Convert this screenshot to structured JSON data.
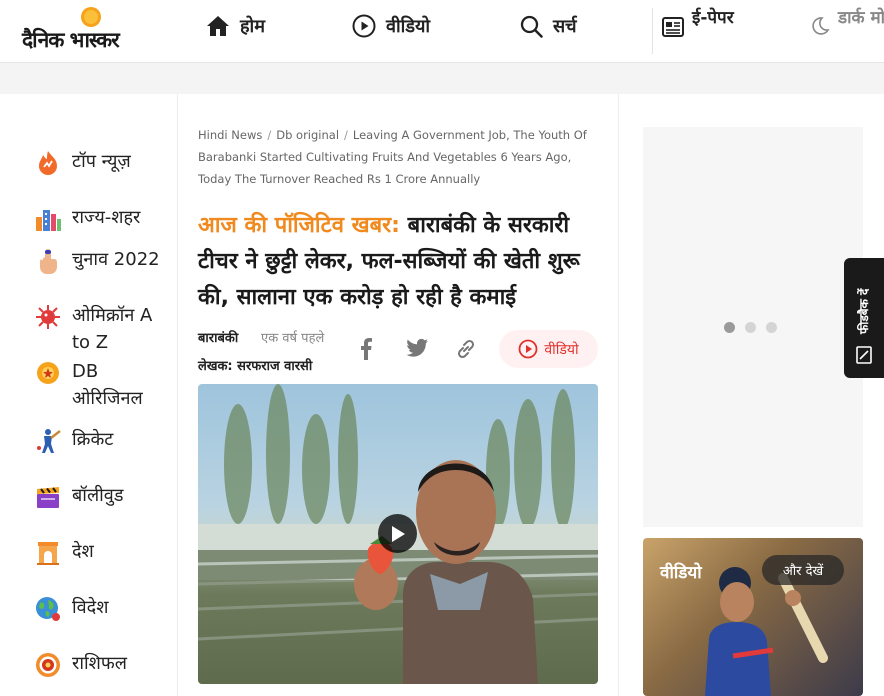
{
  "header": {
    "logo_text": "दैनिक भास्कर",
    "nav": {
      "home": "होम",
      "video": "वीडियो",
      "search": "सर्च",
      "epaper": "ई-पेपर",
      "dark_mode": "डार्क मोड"
    }
  },
  "sidebar": {
    "items": [
      {
        "label": "टॉप न्यूज़",
        "icon": "flame-icon"
      },
      {
        "label": "राज्य-शहर",
        "icon": "city-icon"
      },
      {
        "label": "चुनाव 2022",
        "icon": "voting-finger-icon"
      },
      {
        "label": "ओमिक्रॉन A to Z",
        "icon": "virus-icon"
      },
      {
        "label": "DB ओरिजिनल",
        "icon": "db-original-icon"
      },
      {
        "label": "क्रिकेट",
        "icon": "cricket-icon"
      },
      {
        "label": "बॉलीवुड",
        "icon": "clapperboard-icon"
      },
      {
        "label": "देश",
        "icon": "india-gate-icon"
      },
      {
        "label": "विदेश",
        "icon": "globe-icon"
      },
      {
        "label": "राशिफल",
        "icon": "zodiac-icon"
      }
    ]
  },
  "article": {
    "breadcrumb": {
      "home": "Hindi News",
      "section": "Db original",
      "current": "Leaving A Government Job, The Youth Of Barabanki Started Cultivating Fruits And Vegetables 6 Years Ago, Today The Turnover Reached Rs 1 Crore Annually"
    },
    "kicker": "आज की पॉजिटिव खबर:",
    "headline": "बाराबंकी के सरकारी टीचर ने छुट्टी लेकर, फल-सब्जियों की खेती शुरू की, सालाना एक करोड़ हो रही है कमाई",
    "place": "बाराबंकी",
    "time": "एक वर्ष पहले",
    "author": "लेखक: सरफराज वारसी",
    "video_label": "वीडियो"
  },
  "right_rail": {
    "feedback_label": "फीडबैक दें",
    "video_card_title": "वीडियो",
    "see_more_label": "और देखें"
  },
  "colors": {
    "accent_orange": "#f08a1e",
    "video_red": "#e0312d",
    "dot_active": "#9a9a9a",
    "dot_inactive": "#d4d4d4"
  }
}
